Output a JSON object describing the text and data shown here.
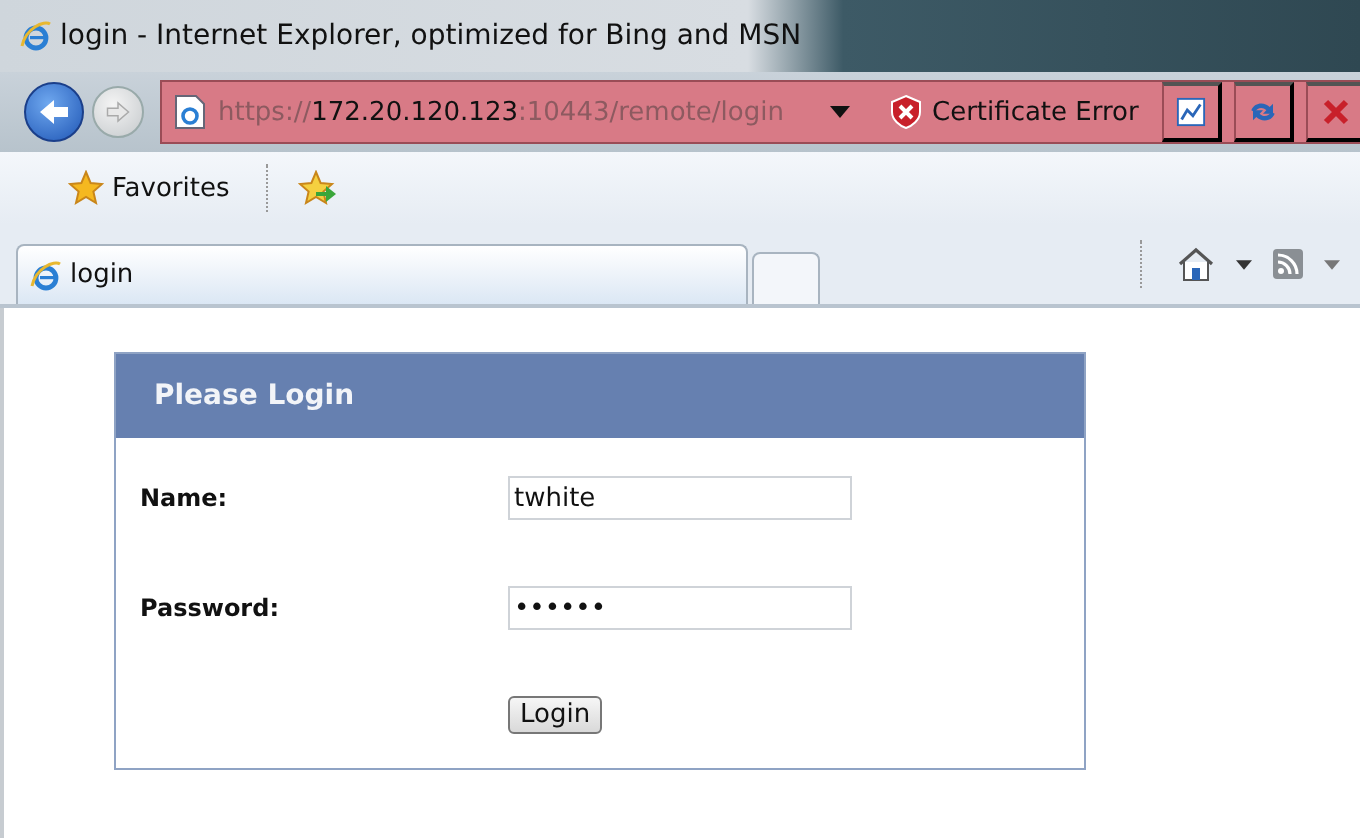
{
  "window": {
    "title": "login - Internet Explorer, optimized for Bing and MSN"
  },
  "address_bar": {
    "scheme": "https://",
    "host": "172.20.120.123",
    "path": ":10443/remote/login",
    "certificate_error": "Certificate Error"
  },
  "favorites_bar": {
    "label": "Favorites"
  },
  "tabs": [
    {
      "label": "login",
      "selected": true
    }
  ],
  "login_panel": {
    "title": "Please Login",
    "fields": [
      {
        "label": "Name:",
        "value": "twhite"
      },
      {
        "label": "Password:",
        "value": "••••••"
      }
    ],
    "button": "Login"
  }
}
